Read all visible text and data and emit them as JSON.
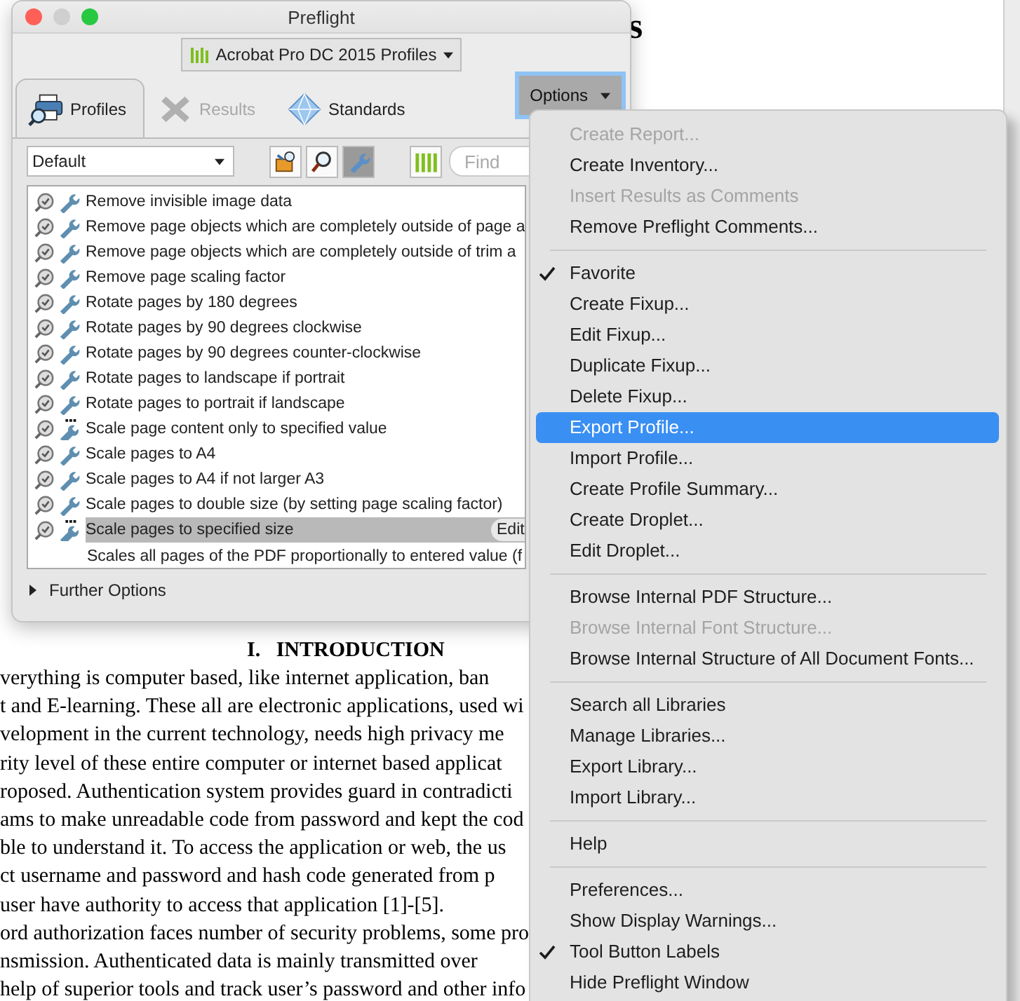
{
  "document": {
    "heading_fragment": "s",
    "heading": "I.   INTRODUCTION",
    "lines": [
      "verything is computer based, like internet application, ban",
      "t and E-learning. These all are electronic applications, used wi",
      "velopment in the current technology, needs high privacy me",
      "rity level of these entire computer or internet based applicat",
      "roposed. Authentication system provides guard in contradicti",
      "ams to make unreadable code from password and kept the cod",
      "ble to understand it. To access the application or web, the us",
      "ct username and password and hash code generated from p",
      "user have authority to access that application [1]-[5].",
      "ord authorization faces number of security problems, some pro",
      "nsmission. Authenticated data is mainly transmitted over",
      "help of superior tools and track user’s password and other info"
    ]
  },
  "window": {
    "title": "Preflight",
    "library": "Acrobat Pro DC 2015 Profiles",
    "tabs": [
      {
        "label": "Profiles",
        "kind": "printer",
        "selected": true,
        "disabled": false
      },
      {
        "label": "Results",
        "kind": "results",
        "selected": false,
        "disabled": true
      },
      {
        "label": "Standards",
        "kind": "diamond",
        "selected": false,
        "disabled": false
      }
    ],
    "options_button": "Options",
    "profile_select": "Default",
    "tools": [
      {
        "kind": "box",
        "selected": false
      },
      {
        "kind": "magnifier",
        "selected": false
      },
      {
        "kind": "wrench",
        "selected": true
      }
    ],
    "search": {
      "placeholder": "Find"
    },
    "fixups": [
      {
        "label": "Remove invisible image data",
        "kind": "wrench",
        "selected": false
      },
      {
        "label": "Remove page objects which are completely outside of page a",
        "kind": "wrench",
        "selected": false
      },
      {
        "label": "Remove page objects which are completely outside of trim a",
        "kind": "wrench",
        "selected": false
      },
      {
        "label": "Remove page scaling factor",
        "kind": "wrench",
        "selected": false
      },
      {
        "label": "Rotate pages by 180 degrees",
        "kind": "wrench",
        "selected": false
      },
      {
        "label": "Rotate pages by 90 degrees clockwise",
        "kind": "wrench",
        "selected": false
      },
      {
        "label": "Rotate pages by 90 degrees counter-clockwise",
        "kind": "wrench",
        "selected": false
      },
      {
        "label": "Rotate pages to landscape if portrait",
        "kind": "wrench",
        "selected": false
      },
      {
        "label": "Rotate pages to portrait if landscape",
        "kind": "wrench",
        "selected": false
      },
      {
        "label": "Scale page content only to specified value",
        "kind": "wrench-dots",
        "selected": false
      },
      {
        "label": "Scale pages to A4",
        "kind": "wrench",
        "selected": false
      },
      {
        "label": "Scale pages to A4 if not larger A3",
        "kind": "wrench",
        "selected": false
      },
      {
        "label": "Scale pages to double size (by setting page scaling factor)",
        "kind": "wrench",
        "selected": false
      },
      {
        "label": "Scale pages to specified size",
        "kind": "wrench-dots",
        "selected": true
      }
    ],
    "edit_button": "Edit",
    "description": "Scales all pages of the PDF proportionally to entered value (f",
    "further_options": "Further Options"
  },
  "menu": {
    "items": [
      {
        "kind": "item",
        "label": "Create Report...",
        "disabled": true,
        "checked": false,
        "selected": false
      },
      {
        "kind": "item",
        "label": "Create Inventory...",
        "disabled": false,
        "checked": false,
        "selected": false
      },
      {
        "kind": "item",
        "label": "Insert Results as Comments",
        "disabled": true,
        "checked": false,
        "selected": false
      },
      {
        "kind": "item",
        "label": "Remove Preflight Comments...",
        "disabled": false,
        "checked": false,
        "selected": false
      },
      {
        "kind": "separator"
      },
      {
        "kind": "item",
        "label": "Favorite",
        "disabled": false,
        "checked": true,
        "selected": false
      },
      {
        "kind": "item",
        "label": "Create Fixup...",
        "disabled": false,
        "checked": false,
        "selected": false
      },
      {
        "kind": "item",
        "label": "Edit Fixup...",
        "disabled": false,
        "checked": false,
        "selected": false
      },
      {
        "kind": "item",
        "label": "Duplicate Fixup...",
        "disabled": false,
        "checked": false,
        "selected": false
      },
      {
        "kind": "item",
        "label": "Delete Fixup...",
        "disabled": false,
        "checked": false,
        "selected": false
      },
      {
        "kind": "item",
        "label": "Export Profile...",
        "disabled": false,
        "checked": false,
        "selected": true
      },
      {
        "kind": "item",
        "label": "Import Profile...",
        "disabled": false,
        "checked": false,
        "selected": false
      },
      {
        "kind": "item",
        "label": "Create Profile Summary...",
        "disabled": false,
        "checked": false,
        "selected": false
      },
      {
        "kind": "item",
        "label": "Create Droplet...",
        "disabled": false,
        "checked": false,
        "selected": false
      },
      {
        "kind": "item",
        "label": "Edit Droplet...",
        "disabled": false,
        "checked": false,
        "selected": false
      },
      {
        "kind": "separator"
      },
      {
        "kind": "item",
        "label": "Browse Internal PDF Structure...",
        "disabled": false,
        "checked": false,
        "selected": false
      },
      {
        "kind": "item",
        "label": "Browse Internal Font Structure...",
        "disabled": true,
        "checked": false,
        "selected": false
      },
      {
        "kind": "item",
        "label": "Browse Internal Structure of All Document Fonts...",
        "disabled": false,
        "checked": false,
        "selected": false
      },
      {
        "kind": "separator"
      },
      {
        "kind": "item",
        "label": "Search all Libraries",
        "disabled": false,
        "checked": false,
        "selected": false
      },
      {
        "kind": "item",
        "label": "Manage Libraries...",
        "disabled": false,
        "checked": false,
        "selected": false
      },
      {
        "kind": "item",
        "label": "Export Library...",
        "disabled": false,
        "checked": false,
        "selected": false
      },
      {
        "kind": "item",
        "label": "Import Library...",
        "disabled": false,
        "checked": false,
        "selected": false
      },
      {
        "kind": "separator"
      },
      {
        "kind": "item",
        "label": "Help",
        "disabled": false,
        "checked": false,
        "selected": false
      },
      {
        "kind": "separator"
      },
      {
        "kind": "item",
        "label": "Preferences...",
        "disabled": false,
        "checked": false,
        "selected": false
      },
      {
        "kind": "item",
        "label": "Show Display Warnings...",
        "disabled": false,
        "checked": false,
        "selected": false
      },
      {
        "kind": "item",
        "label": "Tool Button Labels",
        "disabled": false,
        "checked": true,
        "selected": false
      },
      {
        "kind": "item",
        "label": "Hide Preflight Window",
        "disabled": false,
        "checked": false,
        "selected": false
      }
    ]
  }
}
